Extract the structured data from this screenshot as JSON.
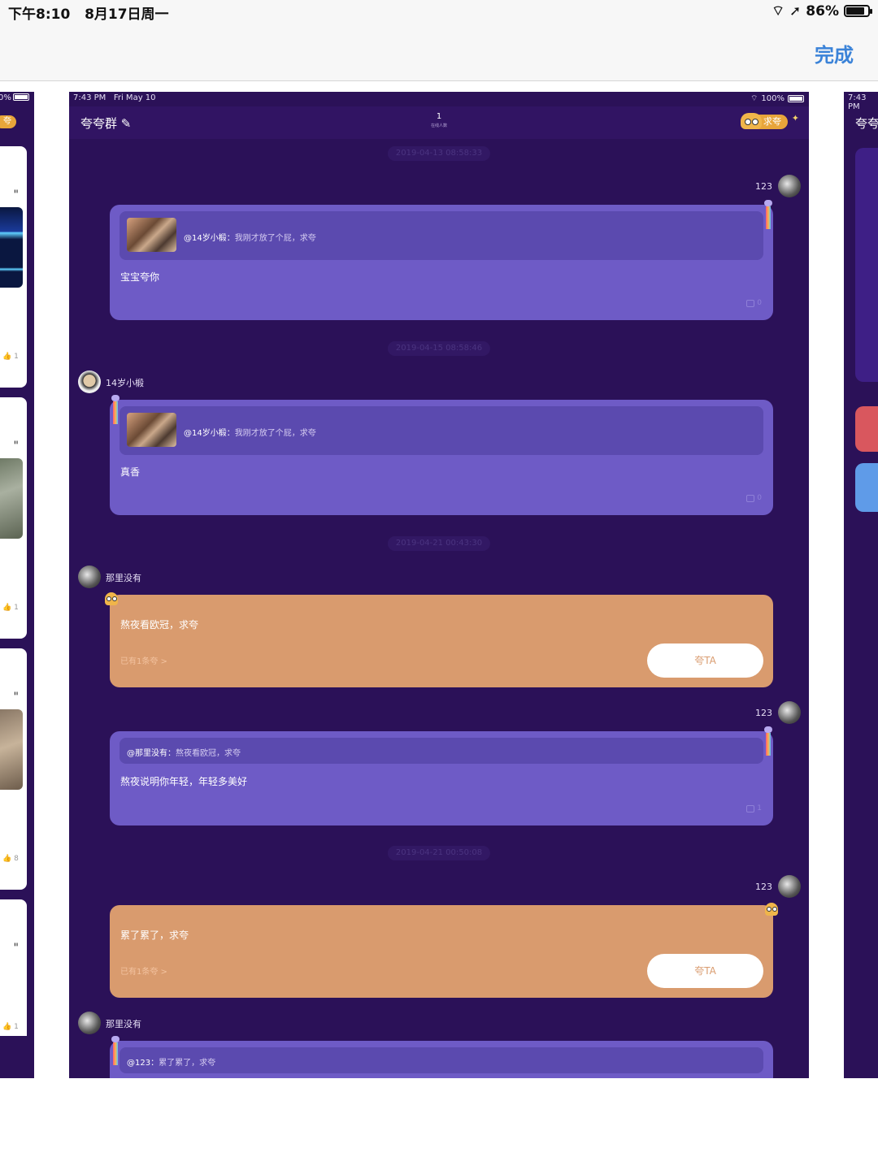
{
  "system_status": {
    "time": "下午8:10",
    "date": "8月17日周一",
    "battery": "86%",
    "battery_level": 0.86
  },
  "toolbar": {
    "done_label": "完成"
  },
  "left_shot": {
    "status_pct": "0%",
    "badge": "夸",
    "quote_mark": "\"",
    "like_counts": [
      "1",
      "1",
      "8",
      "1"
    ]
  },
  "right_shot": {
    "time": "7:43 PM",
    "title": "夸夸"
  },
  "main": {
    "status_bar": {
      "time": "7:43 PM",
      "date": "Fri May 10",
      "battery": "100%"
    },
    "nav": {
      "title": "夸夸群",
      "count": "1",
      "count_sub": "在线人数",
      "ask_label": "求夸"
    },
    "timestamps": [
      "2019-04-13 08:58:33",
      "2019-04-15 08:58:46",
      "2019-04-21 00:43:30",
      "2019-04-21 00:50:08"
    ],
    "messages": [
      {
        "user": "123",
        "quote_user": "@14岁小椴：",
        "quote_text": "我刚才放了个屁，求夸",
        "text": "宝宝夸你",
        "likes": "0"
      },
      {
        "user": "14岁小椴",
        "quote_user": "@14岁小椴：",
        "quote_text": "我刚才放了个屁，求夸",
        "text": "真香",
        "likes": "0"
      },
      {
        "user": "那里没有",
        "text": "熬夜看欧冠，求夸",
        "praise_count": "已有1条夸 >",
        "praise_button": "夸TA"
      },
      {
        "user": "123",
        "quote_user": "@那里没有：",
        "quote_text": "熬夜看欧冠，求夸",
        "text": "熬夜说明你年轻，年轻多美好",
        "likes": "1"
      },
      {
        "user": "123",
        "text": "累了累了，求夸",
        "praise_count": "已有1条夸 >",
        "praise_button": "夸TA"
      },
      {
        "user": "那里没有",
        "quote_user": "@123：",
        "quote_text": "累了累了，求夸"
      }
    ]
  },
  "colors": {
    "bg": "#2b1158",
    "purple_bubble": "#6e5bc6",
    "orange_bubble": "#d99b6e",
    "accent": "#3b83d8"
  }
}
